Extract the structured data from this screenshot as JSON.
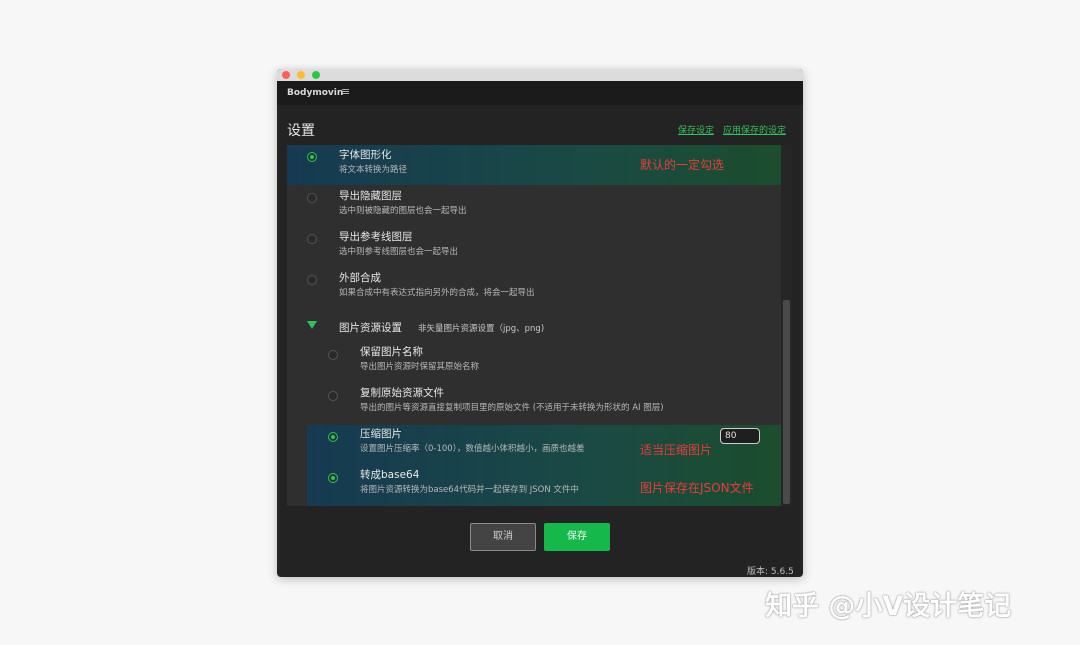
{
  "app": {
    "panel_name": "Bodymovin",
    "menu_icon": "hamburger-icon"
  },
  "header": {
    "title": "设置",
    "save_settings": "保存设定",
    "apply_saved": "应用保存的设定"
  },
  "options": [
    {
      "title": "字体图形化",
      "desc": "将文本转换为路径",
      "checked": true
    },
    {
      "title": "导出隐藏图层",
      "desc": "选中则被隐藏的图层也会一起导出",
      "checked": false
    },
    {
      "title": "导出参考线图层",
      "desc": "选中则参考线图层也会一起导出",
      "checked": false
    },
    {
      "title": "外部合成",
      "desc": "如果合成中有表达式指向另外的合成，将会一起导出",
      "checked": false
    }
  ],
  "image_section": {
    "title": "图片资源设置",
    "subtitle": "非矢量图片资源设置（jpg、png)",
    "expanded": true,
    "items": [
      {
        "title": "保留图片名称",
        "desc": "导出图片资源时保留其原始名称",
        "checked": false
      },
      {
        "title": "复制原始资源文件",
        "desc": "导出的图片等资源直接复制项目里的原始文件 (不适用于未转换为形状的 AI 图层)",
        "checked": false
      },
      {
        "title": "压缩图片",
        "desc": "设置图片压缩率（0-100），数值越小体积越小，画质也越差",
        "checked": true
      },
      {
        "title": "转成base64",
        "desc": "将图片资源转换为base64代码并一起保存到 JSON 文件中",
        "checked": true
      }
    ],
    "quality_value": "80"
  },
  "annotations": {
    "default_checked": "默认的一定勾选",
    "compress": "适当压缩图片",
    "json": "图片保存在JSON文件"
  },
  "buttons": {
    "cancel": "取消",
    "save": "保存"
  },
  "footer": {
    "version": "版本: 5.6.5"
  },
  "watermark": "知乎 @小V设计笔记",
  "colors": {
    "accent": "#2fc25b",
    "annotation": "#ee3b3b",
    "highlight_start": "#163a52",
    "highlight_end": "#1b4d2d"
  }
}
